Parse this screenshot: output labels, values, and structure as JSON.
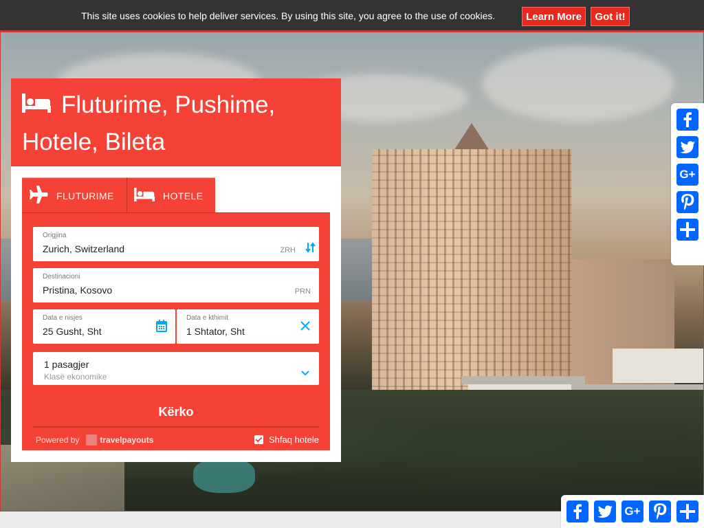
{
  "cookie": {
    "message": "This site uses cookies to help deliver services. By using this site, you agree to the use of cookies.",
    "learn_more": "Learn More",
    "got_it": "Got it!"
  },
  "widget": {
    "title": "Fluturime, Pushime, Hotele, Bileta",
    "tabs": [
      {
        "label": "FLUTURIME",
        "icon": "plane-icon"
      },
      {
        "label": "HOTELE",
        "icon": "bed-icon"
      }
    ],
    "origin": {
      "label": "Origjina",
      "value": "Zurich, Switzerland",
      "code": "ZRH"
    },
    "destination": {
      "label": "Destinacioni",
      "value": "Pristina, Kosovo",
      "code": "PRN"
    },
    "depart": {
      "label": "Data e nisjes",
      "value": "25 Gusht, Sht"
    },
    "return": {
      "label": "Data e kthimit",
      "value": "1 Shtator, Sht"
    },
    "passengers": {
      "count": "1 pasagjer",
      "class": "Klasë ekonomike"
    },
    "search": "Kërko",
    "powered_by": "Powered by",
    "brand": "travelpayouts",
    "show_hotels": "Shfaq hotele",
    "show_hotels_checked": true
  },
  "share": {
    "side": [
      "facebook-icon",
      "twitter-icon",
      "google-plus-icon",
      "pinterest-icon",
      "share-icon"
    ],
    "bottom": [
      "facebook-icon",
      "twitter-icon",
      "google-plus-icon",
      "pinterest-icon",
      "share-icon"
    ],
    "colors": {
      "button": "#0166ff",
      "accent": "#f44336"
    }
  }
}
